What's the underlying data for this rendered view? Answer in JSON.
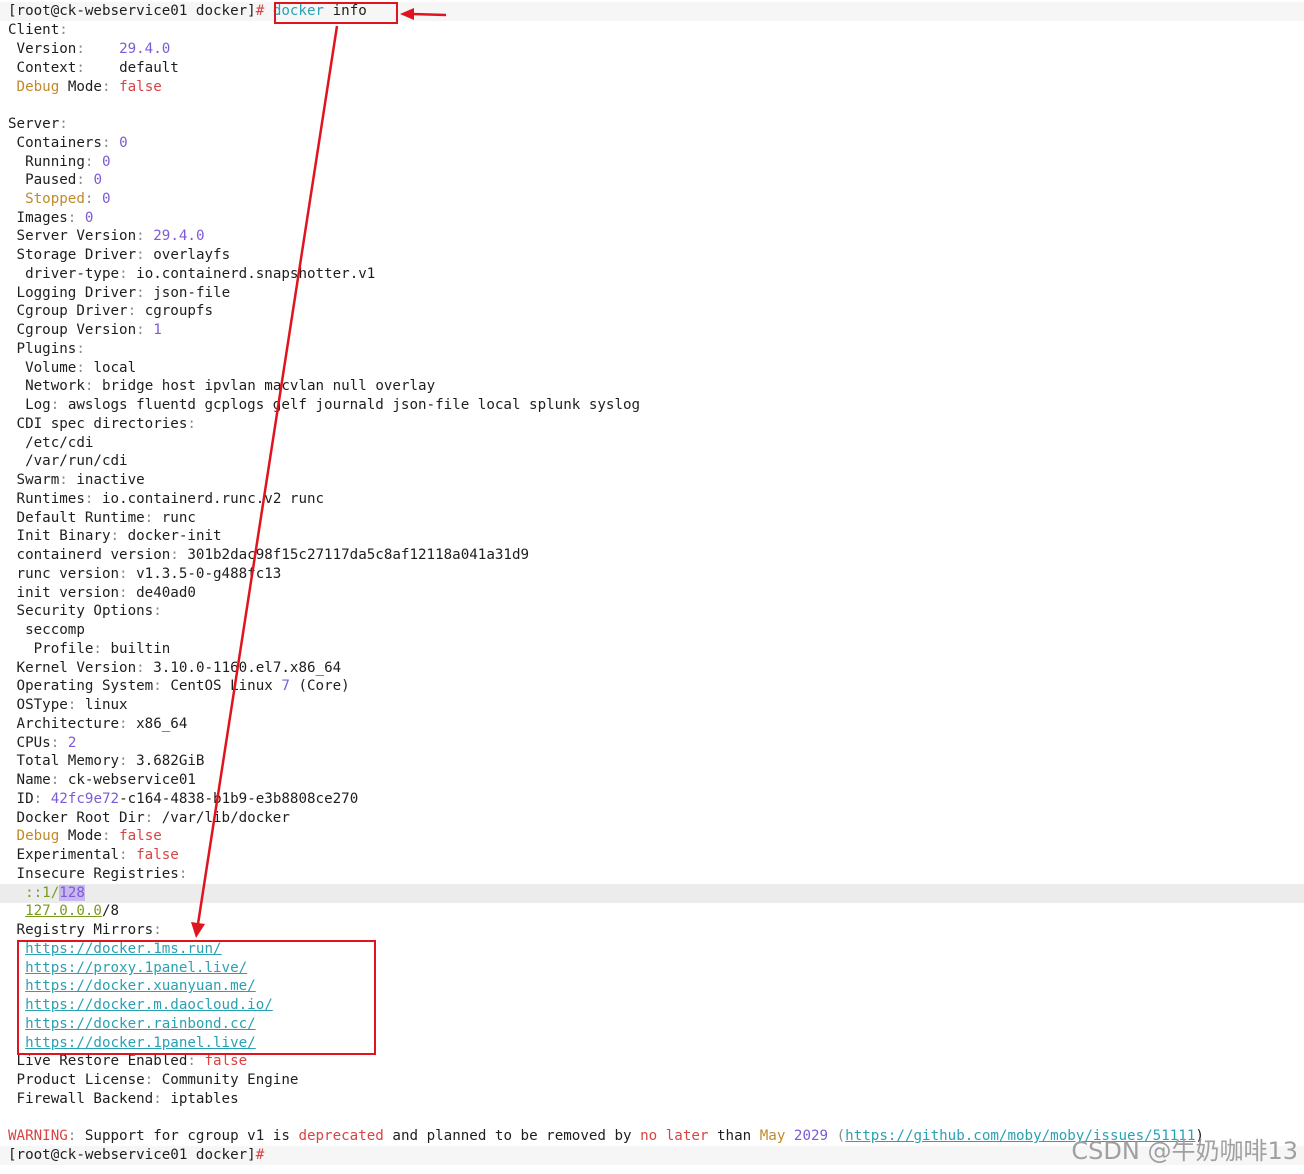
{
  "terminal": {
    "prompt_user": "[root@ck-webservice01 docker]",
    "prompt_symbol": "#",
    "command": "docker info",
    "final_prompt": "[root@ck-webservice01 docker]#"
  },
  "client": {
    "header": "Client",
    "version_label": "Version",
    "version": "29.4.0",
    "context_label": "Context",
    "context": "default",
    "debug_label_a": "Debug",
    "debug_label_b": "Mode",
    "debug": "false"
  },
  "server": {
    "header": "Server",
    "containers_label": "Containers",
    "containers": "0",
    "running_label": "Running",
    "running": "0",
    "paused_label": "Paused",
    "paused": "0",
    "stopped_label": "Stopped",
    "stopped": "0",
    "images_label": "Images",
    "images": "0",
    "server_version_label": "Server Version",
    "server_version": "29.4.0",
    "storage_driver_label": "Storage Driver",
    "storage_driver": "overlayfs",
    "driver_type_label": "driver-type",
    "driver_type": "io.containerd.snapshotter.v1",
    "logging_driver_label": "Logging Driver",
    "logging_driver": "json-file",
    "cgroup_driver_label": "Cgroup Driver",
    "cgroup_driver": "cgroupfs",
    "cgroup_version_label": "Cgroup Version",
    "cgroup_version": "1",
    "plugins_label": "Plugins",
    "volume_label": "Volume",
    "volume": "local",
    "network_label": "Network",
    "network": "bridge host ipvlan macvlan null overlay",
    "log_label": "Log",
    "log": "awslogs fluentd gcplogs gelf journald json-file local splunk syslog",
    "cdi_label": "CDI spec directories",
    "cdi_1": "/etc/cdi",
    "cdi_2": "/var/run/cdi",
    "swarm_label": "Swarm",
    "swarm": "inactive",
    "runtimes_label": "Runtimes",
    "runtimes": "io.containerd.runc.v2 runc",
    "default_runtime_label": "Default Runtime",
    "default_runtime": "runc",
    "init_binary_label": "Init Binary",
    "init_binary": "docker-init",
    "containerd_version_label": "containerd version",
    "containerd_version": "301b2dac98f15c27117da5c8af12118a041a31d9",
    "runc_version_label": "runc version",
    "runc_version": "v1.3.5-0-g488fc13",
    "init_version_label": "init version",
    "init_version": "de40ad0",
    "security_options_label": "Security Options",
    "seccomp": "seccomp",
    "profile_label": "Profile",
    "profile": "builtin",
    "kernel_label": "Kernel Version",
    "kernel": "3.10.0-1160.el7.x86_64",
    "os_label": "Operating System",
    "os_a": "CentOS Linux",
    "os_num": "7",
    "os_b": "(Core)",
    "ostype_label": "OSType",
    "ostype": "linux",
    "arch_label": "Architecture",
    "arch": "x86_64",
    "cpus_label": "CPUs",
    "cpus": "2",
    "memory_label": "Total Memory",
    "memory": "3.682GiB",
    "name_label": "Name",
    "name": "ck-webservice01",
    "id_label": "ID",
    "id_a": "42fc9e72",
    "id_b": "-c164-4838-b1b9-e3b8808ce270",
    "root_dir_label": "Docker Root Dir",
    "root_dir": "/var/lib/docker",
    "debug_label_a": "Debug",
    "debug_label_b": "Mode",
    "debug": "false",
    "experimental_label": "Experimental",
    "experimental": "false",
    "insecure_label": "Insecure Registries",
    "insecure_1a": "::1/",
    "insecure_1b": "128",
    "insecure_2a": "127.0.0.0",
    "insecure_2b": "/8",
    "mirrors_label": "Registry Mirrors",
    "mirrors": [
      "https://docker.1ms.run/",
      "https://proxy.1panel.live/",
      "https://docker.xuanyuan.me/",
      "https://docker.m.daocloud.io/",
      "https://docker.rainbond.cc/",
      "https://docker.1panel.live/"
    ],
    "live_restore_label": "Live Restore Enabled",
    "live_restore": "false",
    "license_label": "Product License",
    "license": "Community Engine",
    "firewall_label": "Firewall Backend",
    "firewall": "iptables"
  },
  "warning": {
    "label": "WARNING",
    "t1": "Support for cgroup v1 is",
    "deprecated": "deprecated",
    "t2": "and planned to be removed by",
    "no_later": "no later",
    "t3": "than",
    "may": "May",
    "year": "2029",
    "link": "https://github.com/moby/moby/issues/51111",
    "close": ")"
  },
  "watermark": "CSDN @牛奶咖啡13",
  "colors": {
    "annotation": "#e0141e",
    "number": "#7d5bd6",
    "false": "#d84343",
    "key_highlight": "#c08a2b",
    "link": "#2aa1b3"
  }
}
